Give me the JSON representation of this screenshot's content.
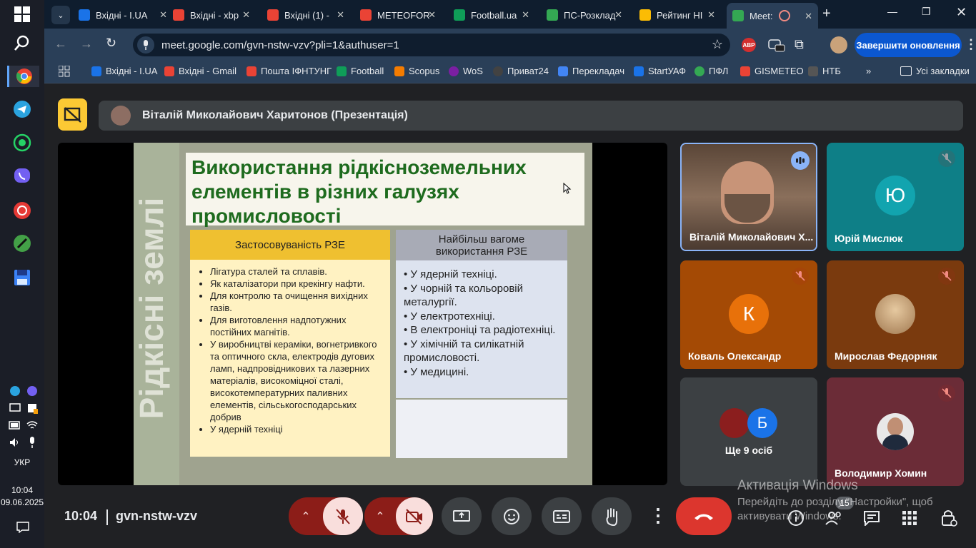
{
  "taskbar": {
    "lang": "УКР",
    "time": "10:04",
    "date": "09.06.2025"
  },
  "tabs": [
    {
      "label": "Вхідні - I.UA",
      "color": "#1a73e8"
    },
    {
      "label": "Вхідні - xbp",
      "color": "#ea4335"
    },
    {
      "label": "Вхідні (1) -",
      "color": "#ea4335"
    },
    {
      "label": "METEOFOR",
      "color": "#ea4335"
    },
    {
      "label": "Football.ua",
      "color": "#0f9d58"
    },
    {
      "label": "ПС-Розклад",
      "color": "#34a853"
    },
    {
      "label": "Рейтинг НІ",
      "color": "#fbbc04"
    },
    {
      "label": "Meet: ",
      "color": "#34a853"
    }
  ],
  "address": {
    "url": "meet.google.com/gvn-nstw-vzv?pli=1&authuser=1",
    "update_button": "Завершити оновлення",
    "abp": "ABP"
  },
  "bookmarks": [
    {
      "label": "Вхідні - I.UA",
      "color": "#1a73e8"
    },
    {
      "label": "Вхідні - Gmail",
      "color": "#ea4335"
    },
    {
      "label": "Пошта ІФНТУНГ",
      "color": "#ea4335"
    },
    {
      "label": "Football",
      "color": "#0f9d58"
    },
    {
      "label": "Scopus",
      "color": "#f57c00"
    },
    {
      "label": "WoS",
      "color": "#7b1fa2"
    },
    {
      "label": "Приват24",
      "color": "#424242"
    },
    {
      "label": "Перекладач",
      "color": "#4285f4"
    },
    {
      "label": "StartУАФ",
      "color": "#1a73e8"
    },
    {
      "label": "ПФЛ",
      "color": "#34a853"
    },
    {
      "label": "GISMETEO",
      "color": "#ea4335"
    },
    {
      "label": "НТБ",
      "color": "#555555"
    }
  ],
  "all_bookmarks": "Усі закладки",
  "presenter": {
    "name": "Віталій Миколайович Харитонов (Презентація)"
  },
  "slide": {
    "side_title": "Рідкісні землі",
    "title": "Використання рідкісноземельних елементів в різних галузях промисловості",
    "left_header": "Застосовуваність РЗЕ",
    "left_items": [
      "Лігатура сталей та сплавів.",
      "Як каталізатори при крекінгу нафти.",
      "Для контролю та очищення вихідних газів.",
      "Для виготовлення надпотужних постійних магнітів.",
      "У виробництві кераміки, вогнетривкого та оптичного скла, електродів дугових ламп, надпровідникових та лазерних матеріалів, високоміцної сталі, високотемпературних паливних елементів, сільськогосподарських добрив",
      "У ядерній техніці"
    ],
    "right_header": "Найбільш вагоме використання РЗЕ",
    "right_items": [
      "• У ядерній техніці.",
      "• У чорній та кольоровій металургії.",
      "• У електротехніці.",
      "• В електроніці та радіотехніці.",
      "• У хімічній та силікатній промисловості.",
      "• У медицині."
    ]
  },
  "participants": [
    {
      "name": "Віталій Миколайович Х...",
      "type": "video"
    },
    {
      "name": "Юрій Мислюк",
      "letter": "Ю",
      "color": "#12a4af"
    },
    {
      "name": "Коваль Олександр",
      "letter": "К",
      "color": "#e8710a"
    },
    {
      "name": "Мирослав Федорняк",
      "type": "image"
    },
    {
      "name": "Ще 9 осіб",
      "letter": "Б",
      "color": "#1a73e8"
    },
    {
      "name": "Володимир Хомин",
      "type": "photo"
    }
  ],
  "meeting": {
    "time": "10:04",
    "code": "gvn-nstw-vzv",
    "people_count": "15"
  },
  "watermark": {
    "title": "Активація Windows",
    "line1": "Перейдіть до розділу \"Настройки\", щоб",
    "line2": "активувати Windows."
  }
}
